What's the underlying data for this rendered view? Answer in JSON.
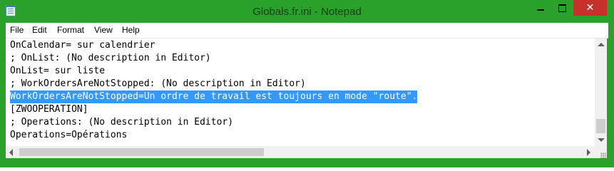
{
  "window": {
    "ghost_title": "C:\\...\\Globals.fr.ini - Notepad",
    "title": "Globals.fr.ini - Notepad",
    "controls": {
      "minimize": "minimize",
      "maximize": "maximize",
      "close": "✕"
    },
    "accent_color": "#2aa12a",
    "close_color": "#c7312b",
    "selection_color": "#3399ff"
  },
  "menu": {
    "items": [
      {
        "label": "File"
      },
      {
        "label": "Edit"
      },
      {
        "label": "Format"
      },
      {
        "label": "View"
      },
      {
        "label": "Help"
      }
    ]
  },
  "editor": {
    "lines": [
      {
        "text": "OnCalendar= sur calendrier",
        "selected": false
      },
      {
        "text": "; OnList: (No description in Editor)",
        "selected": false
      },
      {
        "text": "OnList= sur liste",
        "selected": false
      },
      {
        "text": "; WorkOrdersAreNotStopped: (No description in Editor)",
        "selected": false
      },
      {
        "text": "WorkOrdersAreNotStopped=Un ordre de travail est toujours en mode \"route\".",
        "selected": true
      },
      {
        "text": "[ZWOOPERATION]",
        "selected": false
      },
      {
        "text": "; Operations: (No description in Editor)",
        "selected": false
      },
      {
        "text": "Operations=Opérations",
        "selected": false
      }
    ]
  }
}
